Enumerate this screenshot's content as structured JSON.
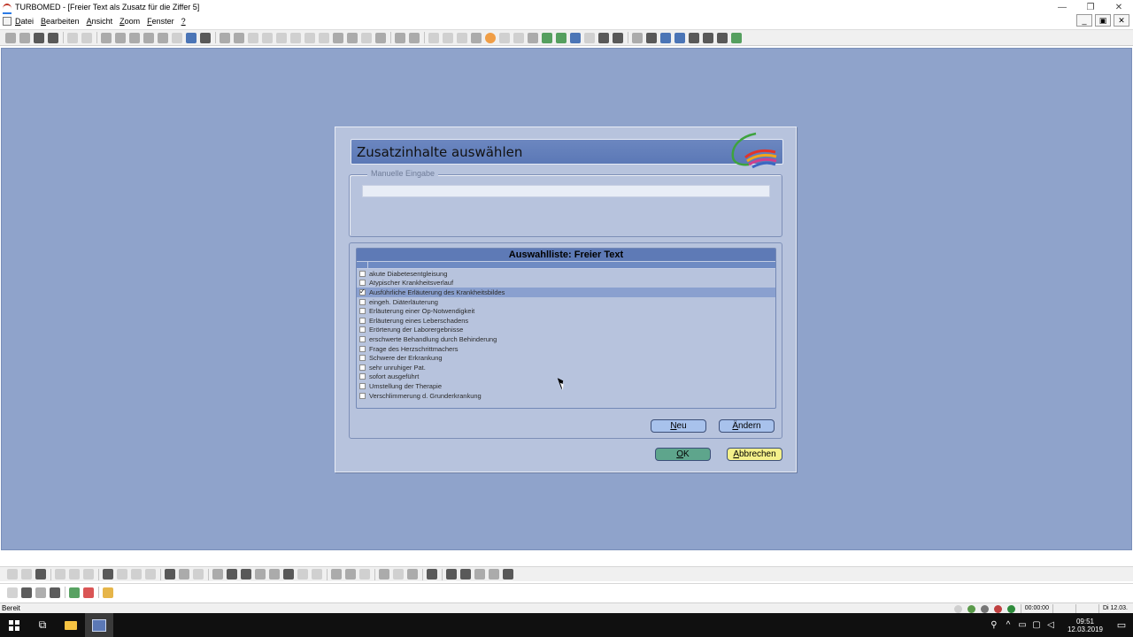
{
  "window": {
    "title": "TURBOMED - [Freier Text als Zusatz für die Ziffer 5]",
    "controls": [
      "—",
      "❐",
      "✕"
    ]
  },
  "menubar": {
    "items": [
      {
        "accel": "D",
        "rest": "atei"
      },
      {
        "accel": "B",
        "rest": "earbeiten"
      },
      {
        "accel": "A",
        "rest": "nsicht"
      },
      {
        "accel": "Z",
        "rest": "oom"
      },
      {
        "accel": "F",
        "rest": "enster"
      },
      {
        "accel": "?",
        "rest": ""
      }
    ],
    "mdi_controls": [
      "_",
      "▣",
      "✕"
    ]
  },
  "dialog": {
    "title": "Zusatzinhalte auswählen",
    "manual_entry": {
      "legend": "Manuelle Eingabe",
      "value": ""
    },
    "list": {
      "title": "Auswahlliste: Freier Text",
      "items": [
        {
          "label": "akute Diabetesentgleisung",
          "checked": false
        },
        {
          "label": "Atypischer Krankheitsverlauf",
          "checked": false
        },
        {
          "label": "Ausführliche Erläuterung des Krankheitsbildes",
          "checked": true
        },
        {
          "label": "eingeh. Diäterläuterung",
          "checked": false
        },
        {
          "label": "Erläuterung einer Op-Notwendigkeit",
          "checked": false
        },
        {
          "label": "Erläuterung eines Leberschadens",
          "checked": false
        },
        {
          "label": "Erörterung der Laborergebnisse",
          "checked": false
        },
        {
          "label": "erschwerte Behandlung durch Behinderung",
          "checked": false
        },
        {
          "label": "Frage des Herzschrittmachers",
          "checked": false
        },
        {
          "label": "Schwere der Erkrankung",
          "checked": false
        },
        {
          "label": "sehr unruhiger Pat.",
          "checked": false
        },
        {
          "label": "sofort ausgeführt",
          "checked": false
        },
        {
          "label": "Umstellung der Therapie",
          "checked": false
        },
        {
          "label": "Verschlimmerung d. Grunderkrankung",
          "checked": false
        }
      ]
    },
    "buttons": {
      "neu": {
        "accel": "N",
        "rest": "eu"
      },
      "aendern": {
        "accel": "Ä",
        "rest": "ndern"
      },
      "ok": {
        "accel": "O",
        "rest": "K"
      },
      "cancel": {
        "accel": "A",
        "rest": "bbrechen"
      }
    }
  },
  "statusbar": {
    "text": "Bereit",
    "timer": "00:00:00",
    "date": "Di 12.03."
  },
  "taskbar": {
    "time": "09:51",
    "date": "12.03.2019"
  },
  "colors": {
    "workspace": "#8fa3cb",
    "dialog_bg": "#b7c3dd",
    "header": "#5b78b6",
    "ok_button": "#5ea58c",
    "cancel_button": "#f4f08a",
    "action_button": "#a8c2ec"
  }
}
